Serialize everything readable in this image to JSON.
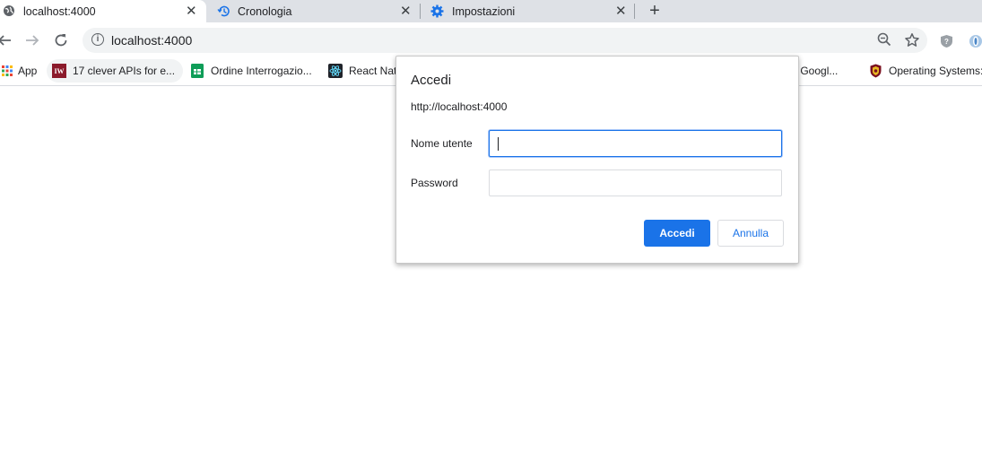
{
  "browser": {
    "tabs": [
      {
        "title": "localhost:4000",
        "icon": "globe-icon",
        "active": true
      },
      {
        "title": "Cronologia",
        "icon": "history-icon",
        "active": false
      },
      {
        "title": "Impostazioni",
        "icon": "settings-gear-icon",
        "active": false
      }
    ],
    "close_glyph": "✕",
    "new_tab_glyph": "+",
    "address": "localhost:4000",
    "info_glyph": "i"
  },
  "bookmarks": [
    {
      "label": "App",
      "icon": "apps-grid-icon"
    },
    {
      "label": "17 clever APIs for e...",
      "icon": "iw-favicon"
    },
    {
      "label": "Ordine Interrogazio...",
      "icon": "google-sheets-icon"
    },
    {
      "label": "React Nat",
      "icon": "react-icon"
    },
    {
      "label": "p - Googl...",
      "icon": ""
    },
    {
      "label": "Operating Systems:...",
      "icon": "shield-crest-icon"
    }
  ],
  "auth_dialog": {
    "title": "Accedi",
    "origin": "http://localhost:4000",
    "username_label": "Nome utente",
    "username_value": "",
    "password_label": "Password",
    "password_value": "",
    "submit_label": "Accedi",
    "cancel_label": "Annulla"
  },
  "colors": {
    "accent": "#1a73e8",
    "tabstrip": "#dee1e6",
    "omnibox": "#f1f3f4"
  }
}
